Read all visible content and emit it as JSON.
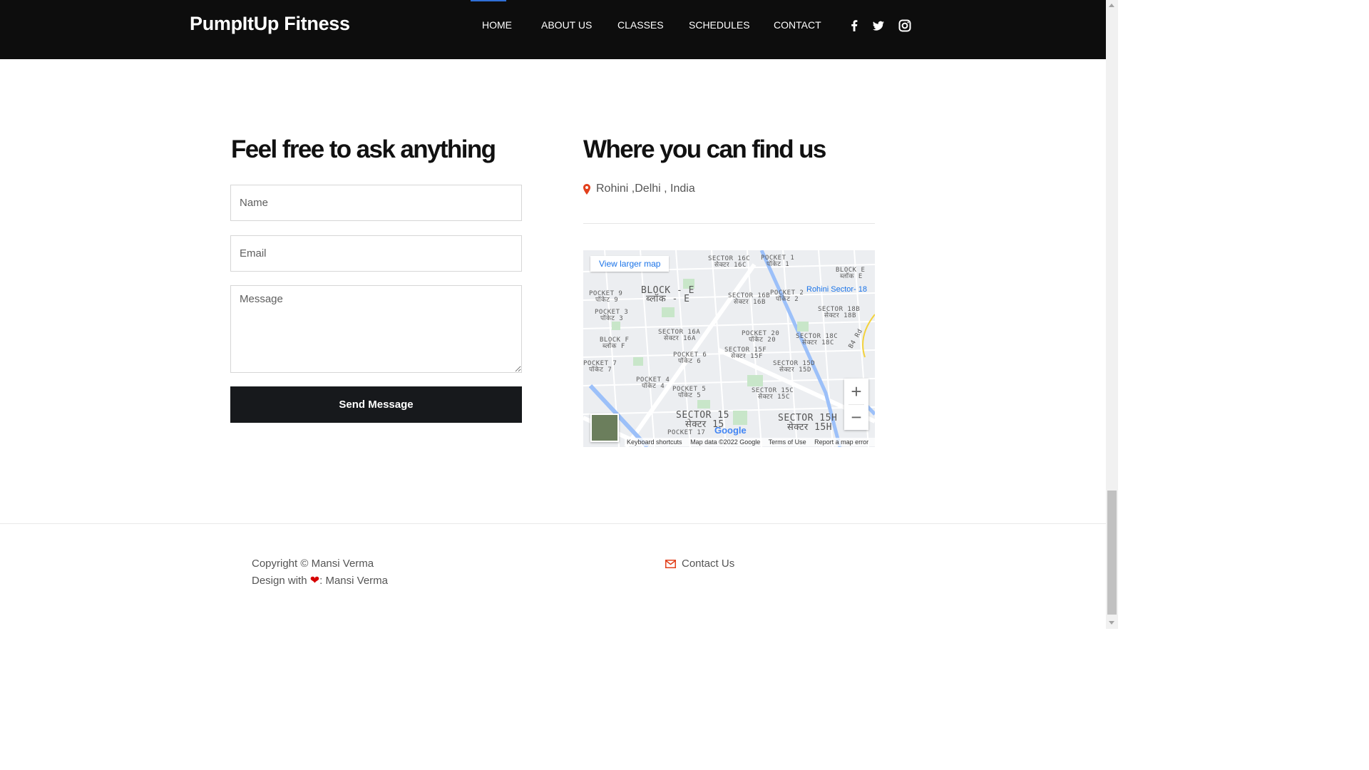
{
  "header": {
    "brand": "PumpItUp Fitness",
    "nav": [
      "HOME",
      "ABOUT US",
      "CLASSES",
      "SCHEDULES",
      "CONTACT"
    ],
    "social_icons": [
      "facebook-icon",
      "twitter-icon",
      "instagram-icon"
    ]
  },
  "contact_form": {
    "title": "Feel free to ask anything",
    "name_placeholder": "Name",
    "email_placeholder": "Email",
    "message_placeholder": "Message",
    "submit_label": "Send Message"
  },
  "location": {
    "title": "Where you can find us",
    "address": "Rohini ,Delhi , India",
    "map": {
      "view_larger": "View larger map",
      "place_name": "Rohini Sector- 18",
      "road_label": "B4 Rd",
      "logo": "Google",
      "footer_links": [
        "Keyboard shortcuts",
        "Map data ©2022 Google",
        "Terms of Use",
        "Report a map error"
      ],
      "labels": [
        "BLOCK - E",
        "ब्लॉक - E",
        "SECTOR 16C",
        "सेक्टर 16C",
        "POCKET 1",
        "पॉकेट 1",
        "SECTOR 16B",
        "सेक्टर 16B",
        "SECTOR 16A",
        "सेक्टर 16A",
        "POCKET 20",
        "पॉकेट 20",
        "SECTOR 15F",
        "सेक्टर 15F",
        "SECTOR 15D",
        "सेक्टर 15D",
        "SECTOR 15C",
        "सेक्टर 15C",
        "SECTOR 15",
        "सेक्टर 15",
        "SECTOR 15H",
        "सेक्टर 15H",
        "SECTOR 18B",
        "सेक्टर 18B",
        "SECTOR 18C",
        "सेक्टर 18C",
        "POCKET 9",
        "पॉकेट 9",
        "POCKET 3",
        "पॉकेट 3",
        "BLOCK F",
        "ब्लॉक F",
        "POCKET 7",
        "पॉकेट 7",
        "POCKET 6",
        "पॉकेट 6",
        "POCKET 4",
        "पॉकेट 4",
        "POCKET 5",
        "पॉकेट 5",
        "POCKET 2",
        "पॉकेट 2",
        "BLOCK E",
        "ब्लॉक E",
        "POCKET 17"
      ]
    }
  },
  "footer": {
    "copyright": "Copyright © Mansi Verma",
    "design_prefix": "Design with",
    "design_suffix": ": Mansi Verma",
    "contact": "Contact Us"
  },
  "colors": {
    "header_bg": "#0d0d0d",
    "button_bg": "#17191c",
    "accent_red": "#e2401c",
    "map_link": "#1a73e8"
  }
}
